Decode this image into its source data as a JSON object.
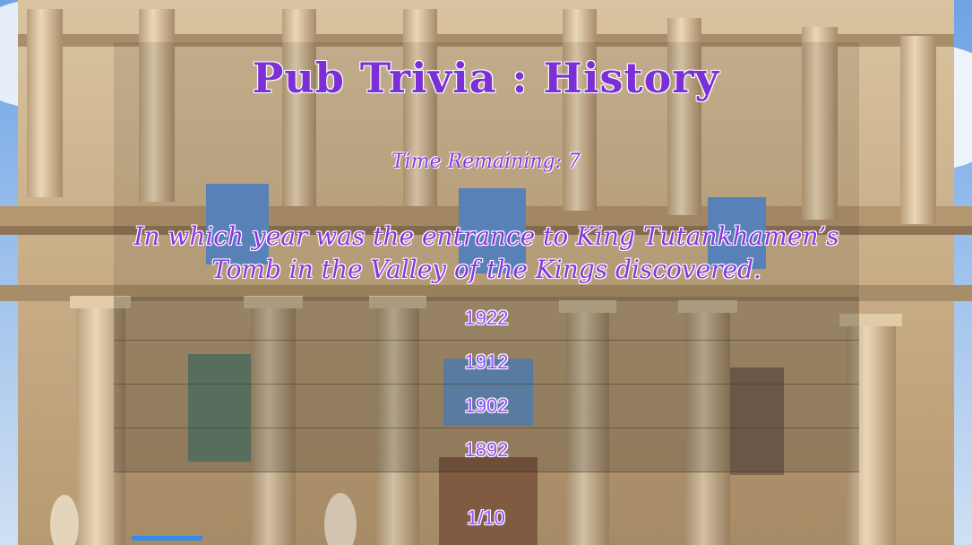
{
  "title": "Pub Trivia : History",
  "timer": {
    "text": "Time Remaining: 7"
  },
  "question": {
    "text": "In which year was the entrance to King Tutankhamen’s Tomb in the Valley of the Kings discovered."
  },
  "answers": [
    {
      "label": "1922"
    },
    {
      "label": "1912"
    },
    {
      "label": "1902"
    },
    {
      "label": "1892"
    }
  ],
  "counter": {
    "text": "1/10"
  },
  "progress": {
    "fraction": 0.1,
    "color": "#2f8df0"
  },
  "colors": {
    "text_accent": "#8a36e0",
    "answer_text": "#9b4dff"
  },
  "background": {
    "icon": "library-facade-image"
  }
}
